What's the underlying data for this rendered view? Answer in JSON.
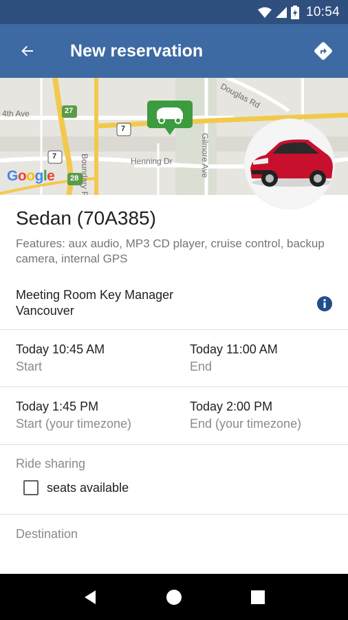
{
  "status_bar": {
    "time": "10:54"
  },
  "app_bar": {
    "title": "New reservation"
  },
  "map": {
    "streets": [
      "4th Ave",
      "Boundary Rd",
      "Henning Dr",
      "Gilmore Ave",
      "Douglas Rd"
    ],
    "route_shields": [
      "27",
      "7",
      "7",
      "28"
    ],
    "google_logo": "Google"
  },
  "vehicle": {
    "title": "Sedan (70A385)",
    "features": "Features: aux audio, MP3 CD player, cruise control, backup camera, internal GPS"
  },
  "location": {
    "name": "Meeting Room Key Manager",
    "city": "Vancouver"
  },
  "times": {
    "start_value": "Today 10:45 AM",
    "start_label": "Start",
    "end_value": "Today 11:00 AM",
    "end_label": "End",
    "tz_start_value": "Today 1:45 PM",
    "tz_start_label": "Start (your timezone)",
    "tz_end_value": "Today 2:00 PM",
    "tz_end_label": "End (your timezone)"
  },
  "ride_sharing": {
    "label": "Ride sharing",
    "checkbox_label": "seats available",
    "checked": false
  },
  "destination": {
    "label": "Destination"
  },
  "colors": {
    "app_bar": "#3d6aa3",
    "status_bar": "#2f4f7f",
    "marker": "#3c9a3f",
    "info": "#1f4e8c"
  }
}
